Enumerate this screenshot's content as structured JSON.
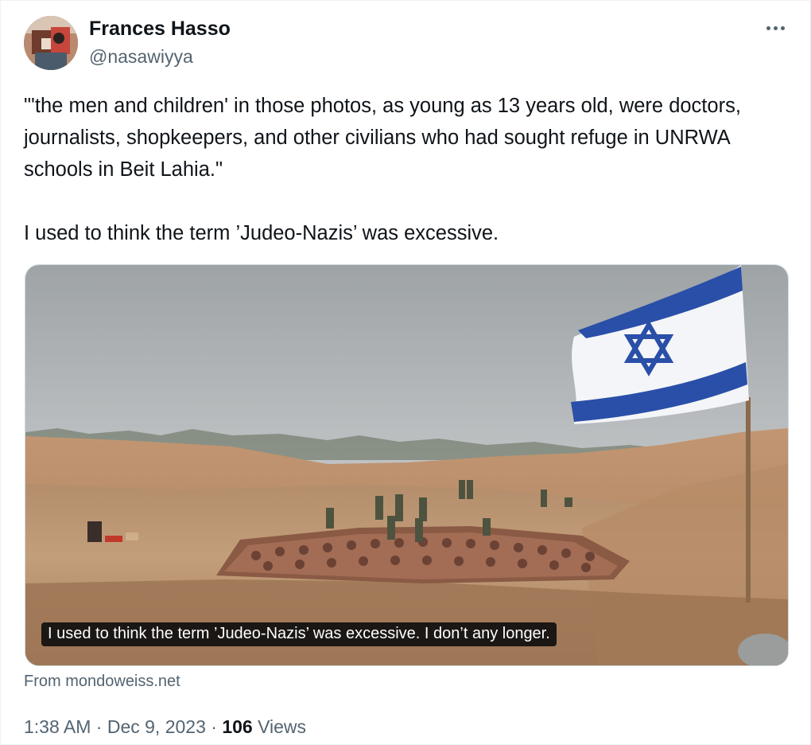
{
  "author": {
    "name": "Frances Hasso",
    "handle": "@nasawiyya"
  },
  "tweet": {
    "paragraphs": [
      "\"'the men and children' in those photos, as young as 13  years old, were doctors, journalists, shopkeepers, and other civilians who had sought refuge in UNRWA schools in Beit Lahia.\"",
      "I used to think the term ’Judeo-Nazis’ was excessive."
    ]
  },
  "media": {
    "caption": "I used to think the term ’Judeo-Nazis’ was excessive. I don’t any longer.",
    "source": "From mondoweiss.net"
  },
  "meta": {
    "time": "1:38 AM",
    "separator": "·",
    "date": "Dec 9, 2023",
    "views_count": "106",
    "views_label": "Views"
  },
  "icons": {
    "more": "more-horizontal-icon"
  },
  "colors": {
    "text_primary": "#0f1419",
    "text_secondary": "#536471",
    "flag_blue": "#2a4fa8"
  }
}
